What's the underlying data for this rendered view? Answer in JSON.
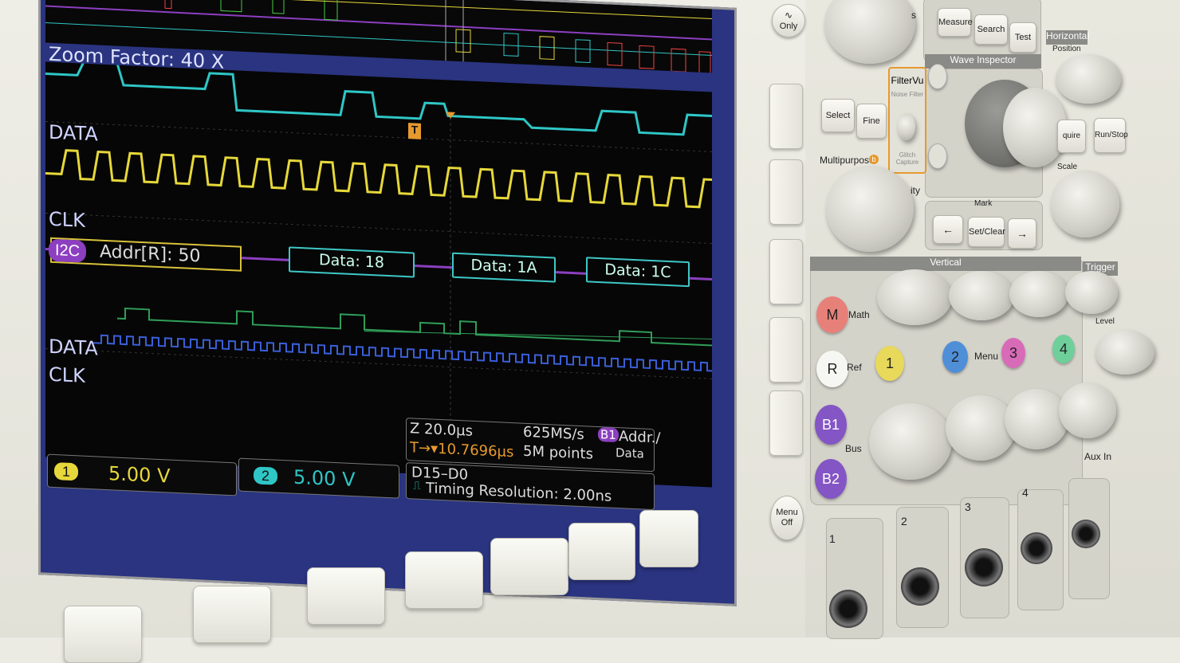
{
  "screen": {
    "zoom_factor": "Zoom Factor: 40 X",
    "labels": {
      "data_top": "DATA",
      "clk_top": "CLK",
      "data_bottom": "DATA",
      "clk_bottom": "CLK"
    },
    "bus": {
      "tag": "I2C",
      "addr": "Addr[R]: 50",
      "packets": [
        "Data: 18",
        "Data: 1A",
        "Data: 1C"
      ]
    },
    "trigger_marker": "T",
    "info": {
      "zoom_time": "Z 20.0µs",
      "trigger_time": "T→▾10.7696µs",
      "sample_rate": "625MS/s",
      "points": "5M points",
      "bus_badge": "B1",
      "bus_decode": "Addr./",
      "bus_decode2": "Data",
      "digital": "D15–D0",
      "timing": "Timing Resolution: 2.00ns"
    },
    "channels": [
      {
        "num": "1",
        "value": "5.00 V",
        "color": "#e6d83a"
      },
      {
        "num": "2",
        "value": "5.00 V",
        "color": "#2fc6c6"
      }
    ],
    "trace_colors": {
      "data": "#2fc6c6",
      "clk": "#e6d83a",
      "bus": "#8c3fc0",
      "digital_data": "#2f9e58",
      "digital_clk": "#3a5fd8"
    }
  },
  "panel": {
    "only_button": "Only",
    "menu_off": "Menu Off",
    "measure": "Measure",
    "search": "Search",
    "test": "Test",
    "horizontal": "Horizontal",
    "position": "Position",
    "wave_inspector": "Wave Inspector",
    "filtervu": "FilterVu",
    "noise_filter": "Noise Filter",
    "glitch_capture": "Glitch Capture",
    "select": "Select",
    "fine": "Fine",
    "multipurpose": "Multipurpose",
    "intensity_suffix": "ity",
    "mark": "Mark",
    "set_clear": "Set/Clear",
    "prev_arrow": "←",
    "next_arrow": "→",
    "acquire_partial": "quire",
    "run_stop": "Run/Stop",
    "scale": "Scale",
    "vertical": "Vertical",
    "trigger": "Trigger",
    "level": "Level",
    "math_btn": "M",
    "math": "Math",
    "ref_btn": "R",
    "ref": "Ref",
    "b1": "B1",
    "b2": "B2",
    "bus": "Bus",
    "menu": "Menu",
    "aux_in": "Aux In",
    "channel_buttons": [
      {
        "label": "1",
        "color": "#e8d95a"
      },
      {
        "label": "2",
        "color": "#4f8fd8"
      },
      {
        "label": "3",
        "color": "#d86bb8"
      },
      {
        "label": "4",
        "color": "#6fcf9a"
      }
    ],
    "input_labels": [
      "1",
      "2",
      "3",
      "4"
    ]
  }
}
